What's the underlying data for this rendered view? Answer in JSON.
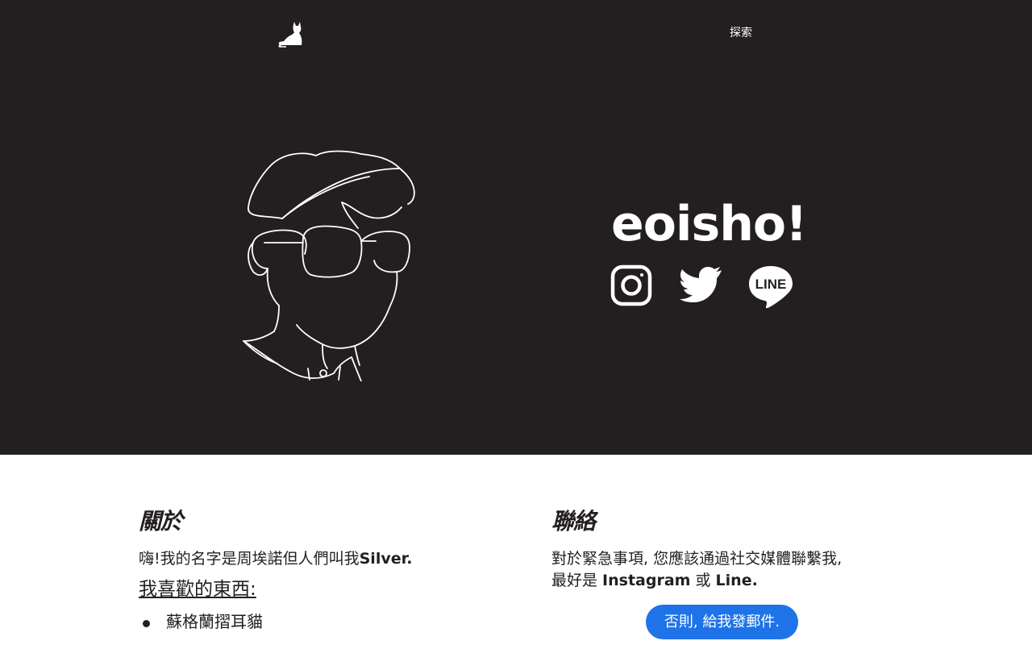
{
  "nav": {
    "explore_label": "探索"
  },
  "hero": {
    "site_name": "eoisho!",
    "social": [
      {
        "name": "Instagram",
        "icon": "instagram-icon"
      },
      {
        "name": "Twitter",
        "icon": "twitter-icon"
      },
      {
        "name": "LINE",
        "icon": "line-icon",
        "icon_text": "LINE"
      }
    ]
  },
  "about": {
    "heading": "關於",
    "intro_prefix": "嗨!我的名字是周埃諾但人們叫我",
    "intro_name": "Silver.",
    "likes_heading": "我喜歡的東西:",
    "likes": [
      "蘇格蘭摺耳貓"
    ]
  },
  "contact": {
    "heading": "聯絡",
    "line1": "對於緊急事項, 您應該通過社交媒體聯繫我,",
    "line2_prefix": "最好是 ",
    "line2_instagram": "Instagram",
    "line2_or": " 或 ",
    "line2_line": "Line.",
    "email_button": "否則, 給我發郵件."
  },
  "colors": {
    "dark": "#231f20",
    "accent": "#1e73e8",
    "light": "#ffffff"
  }
}
